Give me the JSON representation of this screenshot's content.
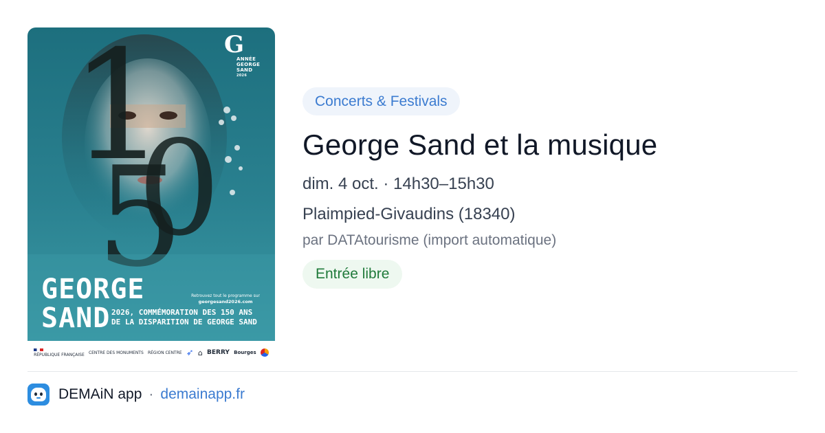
{
  "event": {
    "category": "Concerts & Festivals",
    "title": "George Sand et la musique",
    "date": "dim. 4 oct. · 14h30–15h30",
    "location": "Plaimpied-Givaudins (18340)",
    "source": "par DATAtourisme (import automatique)",
    "price": "Entrée libre"
  },
  "poster": {
    "big_number_1": "1",
    "big_number_5": "5",
    "big_number_0": "0",
    "logo_mark": "G",
    "logo_line_1": "ANNÉE",
    "logo_line_2": "GEORGE",
    "logo_line_3": "SAND",
    "logo_line_4": "2026",
    "title_line_1": "GEORGE",
    "title_line_2": "SAND",
    "subtitle_line_1": "2026, COMMÉMORATION DES 150 ANS",
    "subtitle_line_2": "DE LA DISPARITION DE GEORGE SAND",
    "site_intro": "Retrouvez tout le programme sur",
    "site_url": "georgesand2026.com",
    "partners": {
      "republique": "RÉPUBLIQUE FRANÇAISE",
      "centre": "CENTRE DES MONUMENTS",
      "region": "RÉGION CENTRE",
      "berry": "BERRY",
      "bourges": "Bourges"
    }
  },
  "footer": {
    "app_name": "DEMAiN app",
    "separator": "·",
    "app_url": "demainapp.fr"
  },
  "colors": {
    "category_text": "#3b7bd0",
    "category_bg": "#eff4fb",
    "price_text": "#1f7a3a",
    "price_bg": "#eef8f0",
    "poster_teal": "#1d6f7e",
    "link": "#3b7bd0"
  },
  "icons": {
    "app_icon": "mascot-face-icon"
  }
}
